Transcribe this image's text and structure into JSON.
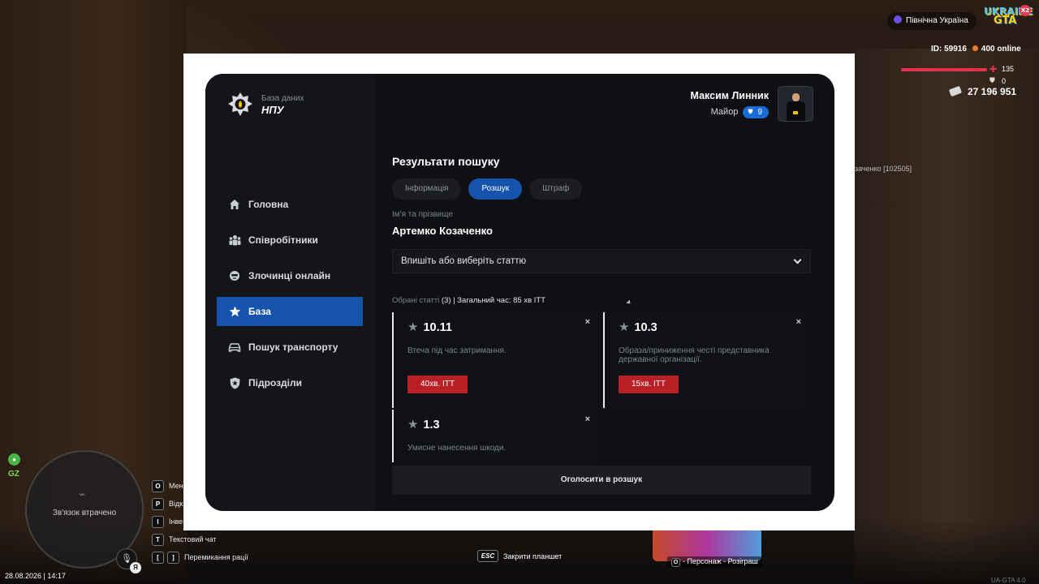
{
  "hud": {
    "region": "Північна Україна",
    "logo_text": "UKRAINE",
    "logo_gta": "GTA",
    "logo_multiplier": "X2",
    "player_id": "ID: 59916",
    "online": "400 online",
    "health": "135",
    "armor": "0",
    "money": "27 196 951",
    "nearby_player": "заченко [102505]",
    "gz_label": "GZ",
    "minimap_status": "Зв'язок втрачено",
    "voice_badge": "Я",
    "datetime": "28.08.2026 | 14:17",
    "hotkeys": [
      {
        "keys": [
          "O"
        ],
        "label": "Мен"
      },
      {
        "keys": [
          "P"
        ],
        "label": "Відк"
      },
      {
        "keys": [
          "I"
        ],
        "label": "Інве"
      },
      {
        "keys": [
          "T"
        ],
        "label": "Текстовий чат"
      },
      {
        "keys": [
          "[",
          "]"
        ],
        "label": "Перемикання рації"
      }
    ],
    "close_tablet_key": "ESC",
    "close_tablet_label": "Закрити планшет",
    "promo_key": "O",
    "promo_label": "- Персонаж - Розіграш",
    "version": "UA-GTA 4.0"
  },
  "tablet": {
    "brand": {
      "subtitle": "База даних",
      "title": "НПУ"
    },
    "nav": [
      {
        "label": "Головна",
        "icon": "home-icon",
        "active": false
      },
      {
        "label": "Співробітники",
        "icon": "staff-icon",
        "active": false
      },
      {
        "label": "Злочинці онлайн",
        "icon": "criminal-icon",
        "active": false
      },
      {
        "label": "База",
        "icon": "star-icon",
        "active": true
      },
      {
        "label": "Пошук транспорту",
        "icon": "car-icon",
        "active": false
      },
      {
        "label": "Підрозділи",
        "icon": "badge-shield-icon",
        "active": false
      }
    ],
    "user": {
      "name": "Максим Линник",
      "rank": "Майор",
      "rank_level": "9"
    },
    "section_title": "Результати пошуку",
    "tabs": [
      {
        "label": "Інформація",
        "active": false
      },
      {
        "label": "Розшук",
        "active": true
      },
      {
        "label": "Штраф",
        "active": false
      }
    ],
    "name_label": "Ім'я та прізвище",
    "name_value": "Артемко Козаченко",
    "article_select_placeholder": "Впишіть або виберіть статтю",
    "selected_label": "Обрані статті",
    "selected_count": "(3)",
    "selected_total": "| Загальний час: 85 хв ITT",
    "articles": [
      {
        "code": "10.11",
        "description": "Втеча під час затримання.",
        "time": "40хв. ITT"
      },
      {
        "code": "10.3",
        "description": "Образа/приниження честі представника державної організації.",
        "time": "15хв. ITT"
      },
      {
        "code": "1.3",
        "description": "Умисне нанесення шкоди.",
        "time": ""
      }
    ],
    "close_symbol": "×",
    "wanted_button": "Оголосити в розшук"
  },
  "colors": {
    "accent": "#1653ad",
    "danger": "#b82025",
    "panel_bg": "#0e1014",
    "sidebar_bg": "#13151a"
  }
}
